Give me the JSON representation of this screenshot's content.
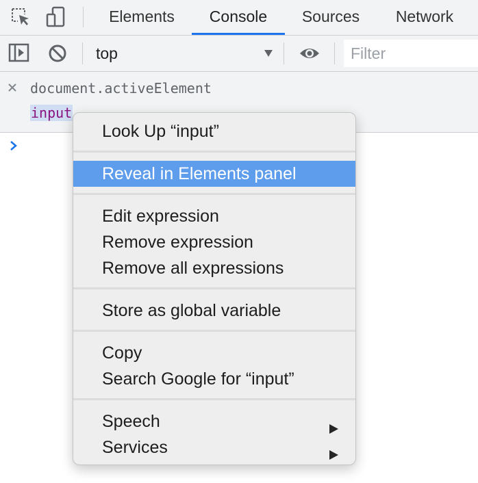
{
  "toolbar_tabs": {
    "tabs": [
      {
        "label": "Elements",
        "active": false
      },
      {
        "label": "Console",
        "active": true
      },
      {
        "label": "Sources",
        "active": false
      },
      {
        "label": "Network",
        "active": false
      }
    ],
    "icons": [
      "inspect-element-icon",
      "device-toolbar-icon"
    ]
  },
  "console_toolbar": {
    "icons": [
      "sidebar-toggle-icon",
      "clear-console-icon",
      "live-expression-eye-icon"
    ],
    "context": "top",
    "filter_placeholder": "Filter"
  },
  "console": {
    "entry": {
      "expression": "document.activeElement",
      "result": "input",
      "icon": "close-icon"
    },
    "prompt_icon": "prompt-chevron-icon"
  },
  "context_menu": {
    "look_up": "Look Up “input”",
    "reveal": "Reveal in Elements panel",
    "edit_expression": "Edit expression",
    "remove_expression": "Remove expression",
    "remove_all_expressions": "Remove all expressions",
    "store_global": "Store as global variable",
    "copy": "Copy",
    "search_google": "Search Google for “input”",
    "speech": "Speech",
    "services": "Services"
  },
  "colors": {
    "accent": "#1a73e8",
    "menu_highlight": "#5e9cec",
    "toolbar_bg": "#f1f3f4",
    "result_text": "#881280"
  }
}
